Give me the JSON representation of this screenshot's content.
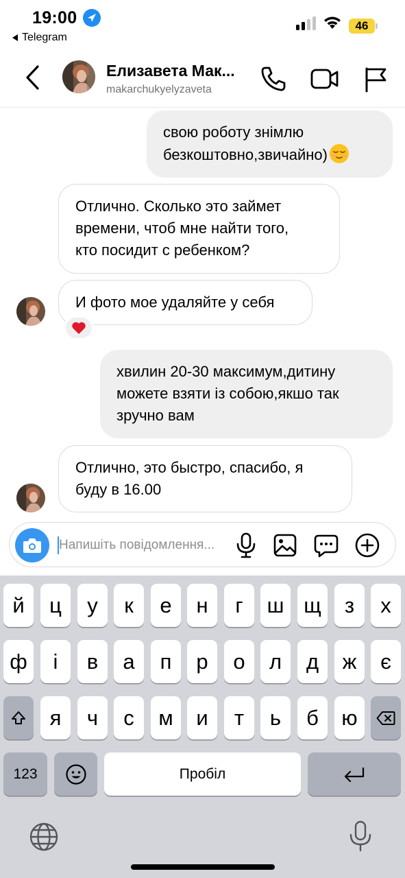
{
  "status_bar": {
    "time": "19:00",
    "back_app_label": "Telegram",
    "battery_level": "46",
    "icons": [
      "location-arrow-icon",
      "signal-icon",
      "wifi-icon",
      "battery-icon"
    ],
    "battery_color": "#f7d33c"
  },
  "header": {
    "contact_name": "Елизавета Мак...",
    "username": "makarchukyelyzaveta",
    "icons": [
      "back-chevron-icon",
      "phone-icon",
      "video-camera-icon",
      "flag-icon"
    ]
  },
  "messages": [
    {
      "direction": "outgoing",
      "lines": [
        "свою роботу знімлю",
        "безкоштовно,звичайно)"
      ],
      "trailing_emoji": "relieved-face-emoji"
    },
    {
      "direction": "incoming",
      "lines": [
        "Отлично. Сколько это займет",
        "времени, чтоб мне найти того,",
        "кто посидит с ребенком?"
      ]
    },
    {
      "direction": "incoming",
      "lines": [
        "И фото мое удаляйте у себя"
      ],
      "reaction": "❤️"
    },
    {
      "direction": "outgoing",
      "lines": [
        "хвилин 20-30 максимум,дитину",
        "можете взяти із собою,якшо так",
        "зручно вам"
      ]
    },
    {
      "direction": "incoming",
      "lines": [
        "Отлично, это быстро, спасибо, я",
        "буду в 16.00"
      ]
    }
  ],
  "composer": {
    "placeholder": "Напишіть повідомлення...",
    "icons": [
      "camera-icon",
      "microphone-icon",
      "gallery-icon",
      "sticker-chat-icon",
      "plus-circle-icon"
    ],
    "accent_color": "#3797f0"
  },
  "keyboard": {
    "row1": [
      "й",
      "ц",
      "у",
      "к",
      "е",
      "н",
      "г",
      "ш",
      "щ",
      "з",
      "х"
    ],
    "row2": [
      "ф",
      "і",
      "в",
      "а",
      "п",
      "р",
      "о",
      "л",
      "д",
      "ж",
      "є"
    ],
    "row3": [
      "я",
      "ч",
      "с",
      "м",
      "и",
      "т",
      "ь",
      "б",
      "ю"
    ],
    "numbers_label": "123",
    "space_label": "Пробіл",
    "icons": [
      "shift-icon",
      "backspace-icon",
      "emoji-icon",
      "return-icon",
      "globe-icon",
      "dictation-mic-icon"
    ]
  }
}
